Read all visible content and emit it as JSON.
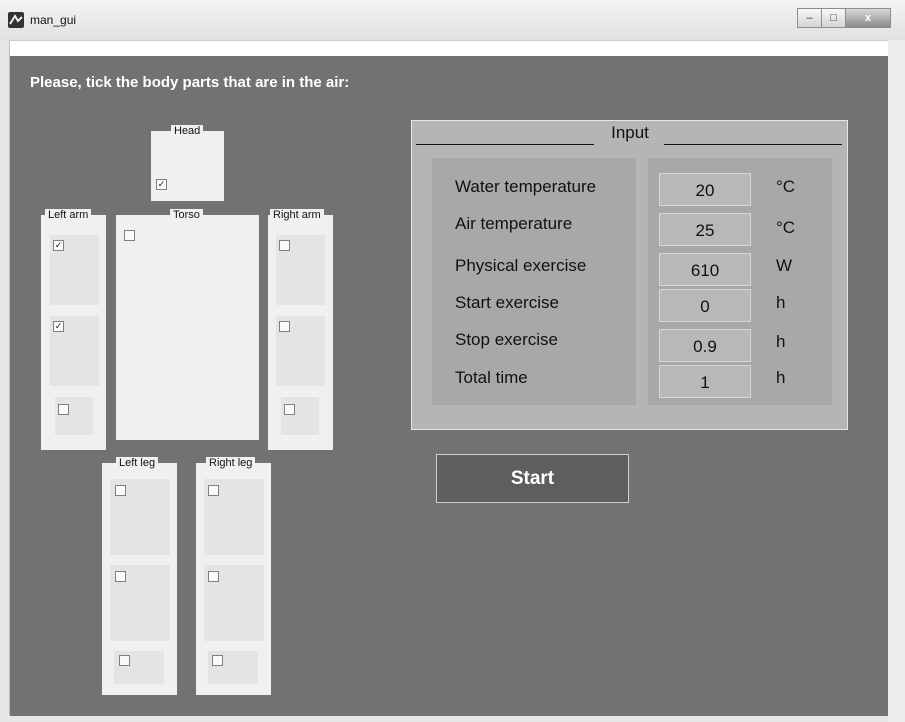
{
  "window": {
    "title": "man_gui",
    "minimize_symbol": "–",
    "maximize_symbol": "□",
    "close_symbol": "x"
  },
  "instruction": "Please,  tick the body parts that are in the air:",
  "body_parts": {
    "head": {
      "label": "Head",
      "checks": [
        true
      ]
    },
    "left_arm": {
      "label": "Left arm",
      "checks": [
        true,
        true,
        false
      ]
    },
    "torso": {
      "label": "Torso",
      "checks": [
        false
      ]
    },
    "right_arm": {
      "label": "Right arm",
      "checks": [
        false,
        false,
        false
      ]
    },
    "left_leg": {
      "label": "Left leg",
      "checks": [
        false,
        false,
        false
      ]
    },
    "right_leg": {
      "label": "Right leg",
      "checks": [
        false,
        false,
        false
      ]
    }
  },
  "input": {
    "title": "Input",
    "rows": [
      {
        "label": "Water temperature",
        "value": "20",
        "unit": "°C"
      },
      {
        "label": "Air temperature",
        "value": "25",
        "unit": "°C"
      },
      {
        "label": "Physical exercise",
        "value": "610",
        "unit": "W"
      },
      {
        "label": "Start exercise",
        "value": "0",
        "unit": "h"
      },
      {
        "label": "Stop exercise",
        "value": "0.9",
        "unit": "h"
      },
      {
        "label": "Total time",
        "value": "1",
        "unit": "h"
      }
    ]
  },
  "start_button": "Start"
}
